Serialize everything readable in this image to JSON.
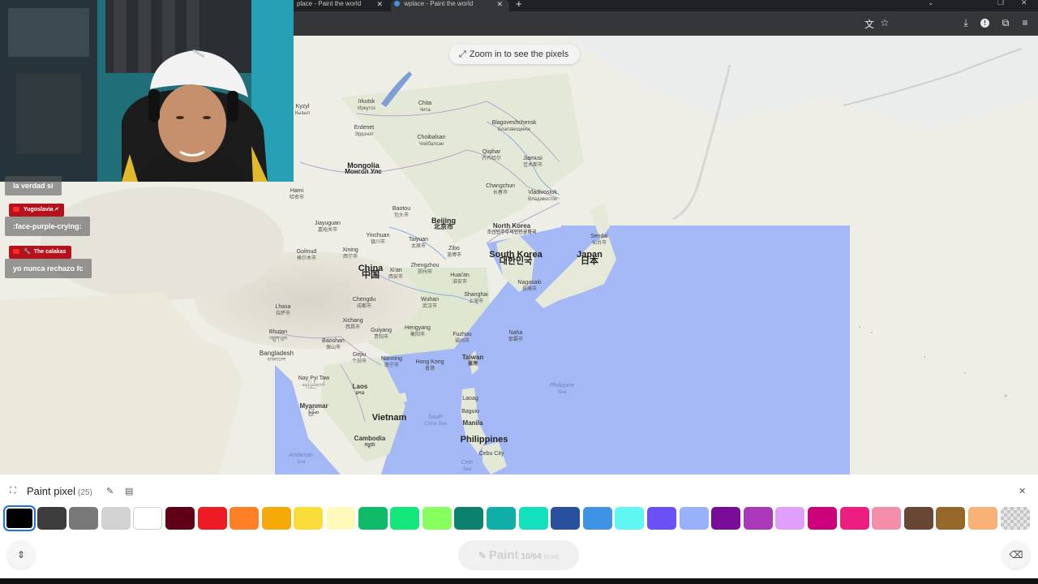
{
  "browser": {
    "tabs": [
      {
        "title": "place - Paint the world",
        "active": false
      },
      {
        "title": "wplace - Paint the world",
        "active": true
      }
    ],
    "toolbar_icons": [
      "translate-icon",
      "star-icon",
      "download-icon",
      "extension-icon",
      "puzzle-icon",
      "menu-icon"
    ]
  },
  "map": {
    "zoom_hint": "Zoom in to see the pixels",
    "labels": {
      "kyzyl": {
        "name": "Kyzyl",
        "local": "Кызыл"
      },
      "irkutsk": {
        "name": "Irkutsk",
        "local": "Иркутск"
      },
      "chita": {
        "name": "Chita",
        "local": "Чита"
      },
      "blagoveshchensk": {
        "name": "Blagoveshchensk",
        "local": "Благовещенск"
      },
      "erdenet": {
        "name": "Erdenet",
        "local": "Эрдэнэт"
      },
      "choibalsan": {
        "name": "Choibalsan",
        "local": "Чойбалсан"
      },
      "qiqihar": {
        "name": "Qiqihar",
        "local": "齐齐哈尔"
      },
      "jiamusi": {
        "name": "Jiamusi",
        "local": "佳木斯市"
      },
      "mongolia": {
        "name": "Mongolia",
        "local": "Монгол Улс"
      },
      "changchun": {
        "name": "Changchun",
        "local": "长春市"
      },
      "vladivostok": {
        "name": "Vladivostok",
        "local": "Владивосток"
      },
      "hami": {
        "name": "Hami",
        "local": "哈密市"
      },
      "baotou": {
        "name": "Baotou",
        "local": "包头市"
      },
      "beijing": {
        "name": "Beijing",
        "local": "北京市"
      },
      "north_korea": {
        "name": "North Korea",
        "local": "조선민주주의인민공화국"
      },
      "sendai": {
        "name": "Sendai",
        "local": "仙台市"
      },
      "jiayuguan": {
        "name": "Jiayuguan",
        "local": "嘉峪关市"
      },
      "yinchuan": {
        "name": "Yinchuan",
        "local": "银川市"
      },
      "taiyuan": {
        "name": "Taiyuan",
        "local": "太原市"
      },
      "south_korea": {
        "name": "South Korea",
        "local": "대한민국"
      },
      "japan": {
        "name": "Japan",
        "local": "日本"
      },
      "golmud": {
        "name": "Golmud",
        "local": "格尔木市"
      },
      "xining": {
        "name": "Xining",
        "local": "西宁市"
      },
      "zibo": {
        "name": "Zibo",
        "local": "淄博市"
      },
      "china": {
        "name": "China",
        "local": "中国"
      },
      "xian": {
        "name": "Xi'an",
        "local": "西安市"
      },
      "zhengzhou": {
        "name": "Zhengzhou",
        "local": "郑州市"
      },
      "huaian": {
        "name": "Huai'an",
        "local": "淮安市"
      },
      "nagasaki": {
        "name": "Nagasaki",
        "local": "長崎市"
      },
      "chengdu": {
        "name": "Chengdu",
        "local": "成都市"
      },
      "wuhan": {
        "name": "Wuhan",
        "local": "武汉市"
      },
      "shanghai": {
        "name": "Shanghai",
        "local": "上海市"
      },
      "lhasa": {
        "name": "Lhasa",
        "local": "拉萨市"
      },
      "xichang": {
        "name": "Xichang",
        "local": "西昌市"
      },
      "hengyang": {
        "name": "Hengyang",
        "local": "衡阳市"
      },
      "fuzhou": {
        "name": "Fuzhou",
        "local": "福州市"
      },
      "naha": {
        "name": "Naha",
        "local": "那覇市"
      },
      "bhutan": {
        "name": "Bhutan",
        "local": "འབྲུག་ཡུལ"
      },
      "guiyang": {
        "name": "Guiyang",
        "local": "贵阳市"
      },
      "baoshan": {
        "name": "Baoshan",
        "local": "保山市"
      },
      "gejiu": {
        "name": "Gejiu",
        "local": "个旧市"
      },
      "bangladesh": {
        "name": "Bangladesh",
        "local": "বাংলাদেশ"
      },
      "nanning": {
        "name": "Nanning",
        "local": "南宁市"
      },
      "hong_kong": {
        "name": "Hong Kong",
        "local": "香港"
      },
      "taiwan": {
        "name": "Taiwan",
        "local": "臺灣"
      },
      "nay_pyi_taw": {
        "name": "Nay Pyi Taw",
        "local": "နေပြည်တော်"
      },
      "laos": {
        "name": "Laos",
        "local": "ລາວ"
      },
      "philippine_sea": {
        "name": "Philippine",
        "local": "Sea"
      },
      "myanmar": {
        "name": "Myanmar",
        "local": "မြန်မာ"
      },
      "laoag": {
        "name": "Laoag",
        "local": ""
      },
      "vietnam": {
        "name": "Vietnam",
        "local": ""
      },
      "baguio": {
        "name": "Baguio",
        "local": ""
      },
      "south_china_sea": {
        "name": "South",
        "local": "China Sea"
      },
      "manila": {
        "name": "Manila",
        "local": ""
      },
      "cambodia": {
        "name": "Cambodia",
        "local": "កម្ពុជា"
      },
      "philippines": {
        "name": "Philippines",
        "local": ""
      },
      "cebu": {
        "name": "Cebu City",
        "local": ""
      },
      "andaman_sea": {
        "name": "Andaman",
        "local": "Sea"
      },
      "celebes": {
        "name": "Cele",
        "local": "Sea"
      }
    }
  },
  "chat": [
    {
      "user": "",
      "text": "la verdad si"
    },
    {
      "user": "Yugoslavia 🗲",
      "text": ":face-purple-crying:"
    },
    {
      "user": "The calakas",
      "text": "yo nunca rechazo fc"
    }
  ],
  "panel": {
    "title": "Paint pixel",
    "count": "(25)",
    "paint_label": "Paint",
    "charges": "10/64",
    "timer": "(0:00)",
    "colors": [
      {
        "name": "Black",
        "hex": "#000000",
        "selected": true
      },
      {
        "name": "Dark Gray",
        "hex": "#3c3c3c"
      },
      {
        "name": "Gray",
        "hex": "#787878"
      },
      {
        "name": "Light Gray",
        "hex": "#d2d2d2"
      },
      {
        "name": "White",
        "hex": "#ffffff"
      },
      {
        "name": "Deep Red",
        "hex": "#600018"
      },
      {
        "name": "Red",
        "hex": "#ed1c24"
      },
      {
        "name": "Orange",
        "hex": "#ff7f27"
      },
      {
        "name": "Gold",
        "hex": "#f6aa09"
      },
      {
        "name": "Yellow",
        "hex": "#f9dd3b"
      },
      {
        "name": "Light Yellow",
        "hex": "#fffabc"
      },
      {
        "name": "Dark Green",
        "hex": "#0eb968"
      },
      {
        "name": "Green",
        "hex": "#13e67b"
      },
      {
        "name": "Light Green",
        "hex": "#87ff5e"
      },
      {
        "name": "Dark Teal",
        "hex": "#0c816e"
      },
      {
        "name": "Teal",
        "hex": "#10aea6"
      },
      {
        "name": "Light Teal",
        "hex": "#13e1be"
      },
      {
        "name": "Dark Blue",
        "hex": "#28509e"
      },
      {
        "name": "Blue",
        "hex": "#4093e4"
      },
      {
        "name": "Cyan",
        "hex": "#60f7f2"
      },
      {
        "name": "Indigo",
        "hex": "#6b50f6"
      },
      {
        "name": "Light Indigo",
        "hex": "#99b1fb"
      },
      {
        "name": "Dark Purple",
        "hex": "#780c99"
      },
      {
        "name": "Purple",
        "hex": "#aa38b9"
      },
      {
        "name": "Light Purple",
        "hex": "#e09ff9"
      },
      {
        "name": "Dark Pink",
        "hex": "#cb007a"
      },
      {
        "name": "Pink",
        "hex": "#ec1f80"
      },
      {
        "name": "Light Pink",
        "hex": "#f38da9"
      },
      {
        "name": "Dark Brown",
        "hex": "#684634"
      },
      {
        "name": "Brown",
        "hex": "#95682a"
      },
      {
        "name": "Beige",
        "hex": "#f8b277"
      },
      {
        "name": "Transparent",
        "hex": "transparent"
      }
    ]
  }
}
